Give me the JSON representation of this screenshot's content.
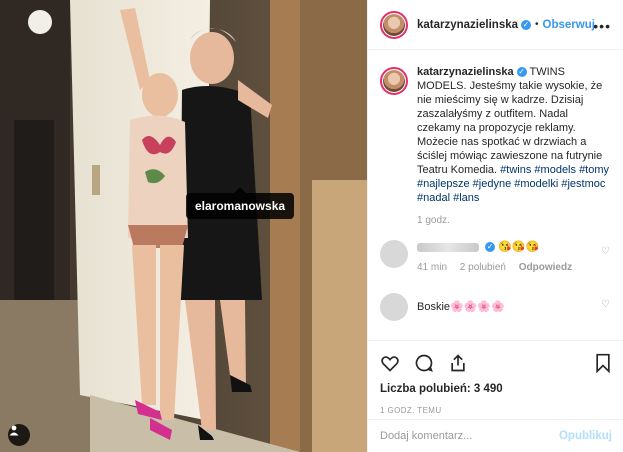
{
  "photo": {
    "tag_label": "elaromanowska",
    "user_tag_icon": "person-icon"
  },
  "header": {
    "username": "katarzynazielinska",
    "verified_icon": "check",
    "separator": "•",
    "follow_label": "Obserwuj",
    "more_icon": "•••"
  },
  "caption": {
    "username": "katarzynazielinska",
    "verified_icon": "check",
    "text": "TWINS MODELS. Jesteśmy takie wysokie, że nie mieścimy się w kadrze. Dzisiaj zaszalałyśmy z outfitem. Nadal czekamy na propozycje reklamy. Możecie nas spotkać w drzwiach a ściślej mówiąc zawieszone na futrynie Teatru Komedia.",
    "hashtags": [
      "#twins",
      "#models",
      "#tomy",
      "#najlepsze",
      "#jedyne",
      "#modelki",
      "#jestmoc",
      "#nadal",
      "#lans"
    ],
    "time": "1 godz."
  },
  "comments": [
    {
      "verified_icon": "check",
      "text": "😘😘😘",
      "time": "41 min",
      "likes": "2 polubień",
      "reply": "Odpowiedz"
    },
    {
      "text": "Boskie🌸🌸🌸🌸"
    }
  ],
  "actions": {
    "likes_label": "Liczba polubień: 3 490",
    "posted": "1 GODZ. TEMU"
  },
  "add_comment": {
    "placeholder": "Dodaj komentarz...",
    "publish_label": "Opublikuj"
  },
  "colors": {
    "accent": "#3897f0",
    "hashtag": "#003569",
    "muted": "#999999",
    "publish_disabled": "#b2dffc"
  }
}
